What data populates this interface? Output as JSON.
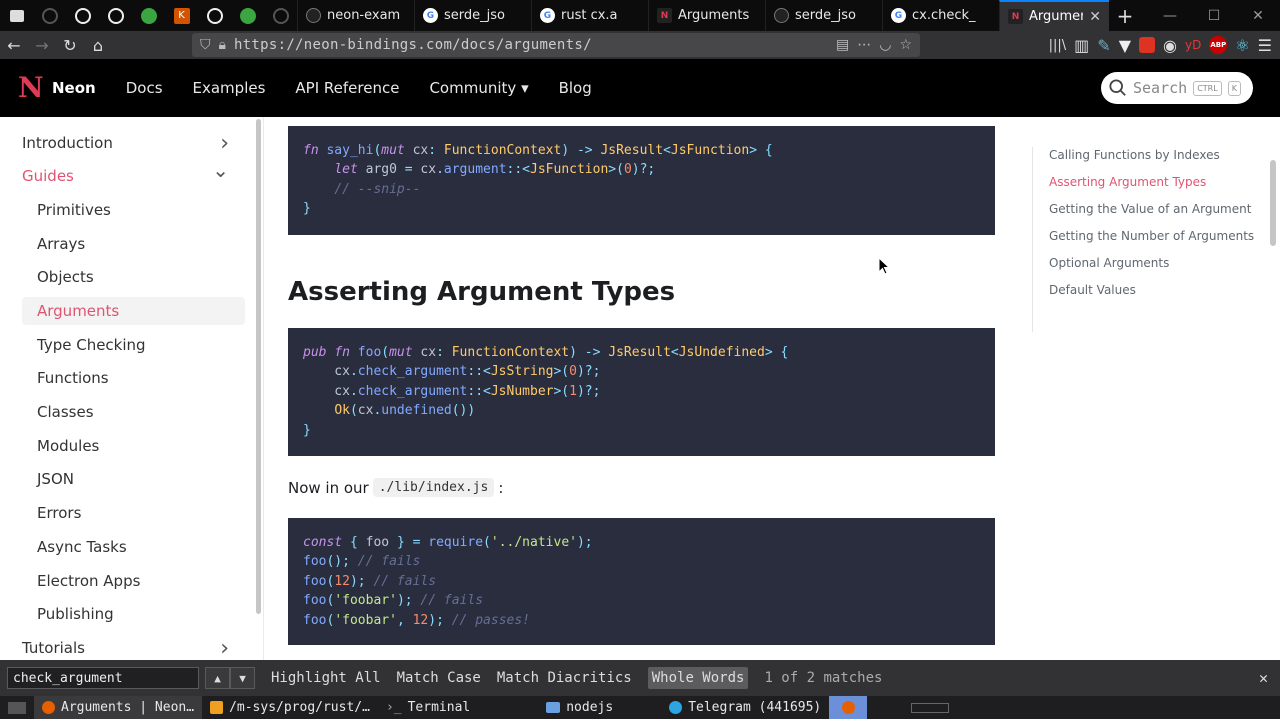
{
  "browser": {
    "tabs": [
      {
        "label": "neon-exam",
        "icon": "github-icon",
        "active": false
      },
      {
        "label": "serde_jso",
        "icon": "google-icon",
        "active": false
      },
      {
        "label": "rust cx.a",
        "icon": "google-icon",
        "active": false
      },
      {
        "label": "Arguments",
        "icon": "neon-icon",
        "active": false
      },
      {
        "label": "serde_jso",
        "icon": "github-icon",
        "active": false
      },
      {
        "label": "cx.check_",
        "icon": "google-icon",
        "active": false
      },
      {
        "label": "Argumen",
        "icon": "neon-icon",
        "active": true
      }
    ],
    "new_tab": "+",
    "url": "https://neon-bindings.com/docs/arguments/"
  },
  "site": {
    "brand": "Neon",
    "logo": "N",
    "nav": [
      "Docs",
      "Examples",
      "API Reference",
      "Community",
      "Blog"
    ],
    "community_caret": "▾",
    "search_placeholder": "Search",
    "search_kbd1": "CTRL",
    "search_kbd2": "K"
  },
  "sidebar": {
    "sections": [
      {
        "label": "Introduction",
        "chevron": "›"
      },
      {
        "label": "Guides",
        "chevron": "⌄"
      },
      {
        "label": "Tutorials",
        "chevron": "›"
      }
    ],
    "guides": [
      "Primitives",
      "Arrays",
      "Objects",
      "Arguments",
      "Type Checking",
      "Functions",
      "Classes",
      "Modules",
      "JSON",
      "Errors",
      "Async Tasks",
      "Electron Apps",
      "Publishing"
    ],
    "active": "Arguments"
  },
  "content": {
    "heading": "Asserting Argument Types",
    "para_prefix": "Now in our",
    "para_code": "./lib/index.js",
    "para_suffix": ":"
  },
  "toc": [
    "Calling Functions by Indexes",
    "Asserting Argument Types",
    "Getting the Value of an Argument",
    "Getting the Number of Arguments",
    "Optional Arguments",
    "Default Values"
  ],
  "findbar": {
    "query": "check_argument",
    "prev": "▲",
    "next": "▼",
    "options": [
      "Highlight All",
      "Match Case",
      "Match Diacritics",
      "Whole Words"
    ],
    "active_option": "Whole Words",
    "count": "1 of 2 matches",
    "close": "✕"
  },
  "taskbar": [
    {
      "label": "Arguments | Neon…",
      "active": true,
      "color": "#e66000"
    },
    {
      "label": "/m-sys/prog/rust/…",
      "active": false,
      "color": "#f0a020"
    },
    {
      "label": "Terminal",
      "active": false,
      "color": "#888888"
    },
    {
      "label": "nodejs",
      "active": false,
      "color": "#6aa0e0"
    },
    {
      "label": "Telegram (441695)",
      "active": false,
      "color": "#2ca5e0"
    }
  ],
  "colors": {
    "accent": "#e05470",
    "code_bg": "#292d3e",
    "header_bg": "#000000"
  }
}
